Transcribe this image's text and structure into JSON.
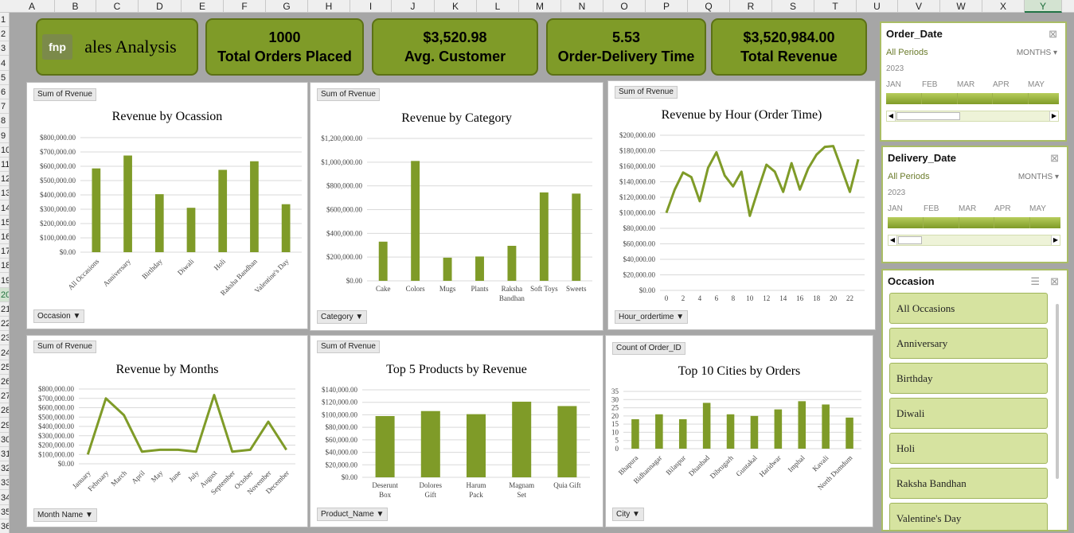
{
  "columns": [
    "A",
    "B",
    "C",
    "D",
    "E",
    "F",
    "G",
    "H",
    "I",
    "J",
    "K",
    "L",
    "M",
    "N",
    "O",
    "P",
    "Q",
    "R",
    "S",
    "T",
    "U",
    "V",
    "W",
    "X",
    "Y"
  ],
  "rows": [
    "1",
    "2",
    "3",
    "4",
    "5",
    "6",
    "7",
    "8",
    "9",
    "10",
    "11",
    "12",
    "13",
    "14",
    "15",
    "16",
    "17",
    "18",
    "19",
    "20",
    "21",
    "22",
    "23",
    "24",
    "25",
    "26",
    "27",
    "28",
    "29",
    "30",
    "31",
    "32",
    "33",
    "34",
    "35",
    "36"
  ],
  "selected_column": "Y",
  "selected_row": "20",
  "kpis": {
    "title_logo": "fnp",
    "title_text": "ales Analysis",
    "orders_value": "1000",
    "orders_label": "Total Orders Placed",
    "avg_value": "$3,520.98",
    "avg_label": "Avg. Customer",
    "delivery_value": "5.53",
    "delivery_label": "Order-Delivery Time",
    "revenue_value": "$3,520,984.00",
    "revenue_label": "Total Revenue"
  },
  "charts": {
    "occasion": {
      "tag": "Sum of Rvenue",
      "title": "Revenue by Ocassion",
      "filter": "Occasion"
    },
    "category": {
      "tag": "Sum of Rvenue",
      "title": "Revenue by Category",
      "filter": "Category"
    },
    "hour": {
      "tag": "Sum of Rvenue",
      "title": "Revenue by Hour (Order Time)",
      "filter": "Hour_ordertime"
    },
    "months": {
      "tag": "Sum of Rvenue",
      "title": "Revenue by Months",
      "filter": "Month Name"
    },
    "products": {
      "tag": "Sum of Rvenue",
      "title": "Top 5 Products by Revenue",
      "filter": "Product_Name"
    },
    "cities": {
      "tag": "Count of Order_ID",
      "title": "Top 10 Cities by Orders",
      "filter": "City"
    }
  },
  "chart_data": [
    {
      "id": "occasion",
      "type": "bar",
      "title": "Revenue by Ocassion",
      "categories": [
        "All Occasions",
        "Anniversary",
        "Birthday",
        "Diwali",
        "Holi",
        "Raksha Bandhan",
        "Valentine's Day"
      ],
      "values": [
        585000,
        675000,
        405000,
        310000,
        575000,
        635000,
        335000
      ],
      "ylim": [
        0,
        800000
      ],
      "yticks": [
        "$0.00",
        "$100,000.00",
        "$200,000.00",
        "$300,000.00",
        "$400,000.00",
        "$500,000.00",
        "$600,000.00",
        "$700,000.00",
        "$800,000.00"
      ],
      "color": "#7f9b28"
    },
    {
      "id": "category",
      "type": "bar",
      "title": "Revenue by Category",
      "categories": [
        "Cake",
        "Colors",
        "Mugs",
        "Plants",
        "Raksha Bandhan",
        "Soft Toys",
        "Sweets"
      ],
      "values": [
        330000,
        1010000,
        195000,
        205000,
        295000,
        745000,
        735000
      ],
      "ylim": [
        0,
        1200000
      ],
      "yticks": [
        "$0.00",
        "$200,000.00",
        "$400,000.00",
        "$600,000.00",
        "$800,000.00",
        "$1,000,000.00",
        "$1,200,000.00"
      ],
      "color": "#7f9b28"
    },
    {
      "id": "hour",
      "type": "line",
      "title": "Revenue by Hour (Order Time)",
      "x": [
        0,
        1,
        2,
        3,
        4,
        5,
        6,
        7,
        8,
        9,
        10,
        11,
        12,
        13,
        14,
        15,
        16,
        17,
        18,
        19,
        20,
        21,
        22,
        23
      ],
      "values": [
        100000,
        130000,
        152000,
        146000,
        115000,
        158000,
        178000,
        148000,
        134000,
        153000,
        96000,
        130000,
        162000,
        153000,
        127000,
        164000,
        130000,
        157000,
        175000,
        185000,
        186000,
        157000,
        127000,
        169000
      ],
      "xticks": [
        "0",
        "2",
        "4",
        "6",
        "8",
        "10",
        "12",
        "14",
        "16",
        "18",
        "20",
        "22"
      ],
      "ylim": [
        0,
        200000
      ],
      "yticks": [
        "$0.00",
        "$20,000.00",
        "$40,000.00",
        "$60,000.00",
        "$80,000.00",
        "$100,000.00",
        "$120,000.00",
        "$140,000.00",
        "$160,000.00",
        "$180,000.00",
        "$200,000.00"
      ],
      "color": "#7f9b28"
    },
    {
      "id": "months",
      "type": "line",
      "title": "Revenue by Months",
      "categories": [
        "January",
        "February",
        "March",
        "April",
        "May",
        "June",
        "July",
        "August",
        "September",
        "October",
        "November",
        "December"
      ],
      "values": [
        100000,
        700000,
        520000,
        130000,
        150000,
        150000,
        130000,
        735000,
        130000,
        150000,
        450000,
        150000
      ],
      "ylim": [
        0,
        800000
      ],
      "yticks": [
        "$0.00",
        "$100,000.00",
        "$200,000.00",
        "$300,000.00",
        "$400,000.00",
        "$500,000.00",
        "$600,000.00",
        "$700,000.00",
        "$800,000.00"
      ],
      "color": "#7f9b28"
    },
    {
      "id": "products",
      "type": "bar",
      "title": "Top 5 Products by Revenue",
      "categories": [
        "Deserunt Box",
        "Dolores Gift",
        "Harum Pack",
        "Magnam Set",
        "Quia Gift"
      ],
      "values": [
        98000,
        106000,
        101000,
        121000,
        114000
      ],
      "ylim": [
        0,
        140000
      ],
      "yticks": [
        "$0.00",
        "$20,000.00",
        "$40,000.00",
        "$60,000.00",
        "$80,000.00",
        "$100,000.00",
        "$120,000.00",
        "$140,000.00"
      ],
      "color": "#7f9b28"
    },
    {
      "id": "cities",
      "type": "bar",
      "title": "Top 10 Cities by Orders",
      "categories": [
        "Bhapura",
        "Bidhannagar",
        "Bilaspur",
        "Dhanbad",
        "Dibrugarh",
        "Guntakal",
        "Haridwar",
        "Imphal",
        "Kavali",
        "North Dumdum"
      ],
      "values": [
        18,
        21,
        18,
        28,
        21,
        20,
        24,
        29,
        27,
        19
      ],
      "ylim": [
        0,
        35
      ],
      "yticks": [
        "0",
        "5",
        "10",
        "15",
        "20",
        "25",
        "30",
        "35"
      ],
      "color": "#7f9b28"
    }
  ],
  "slicers": {
    "order_date": {
      "title": "Order_Date",
      "period": "All Periods",
      "unit": "MONTHS",
      "year": "2023",
      "months": [
        "JAN",
        "FEB",
        "MAR",
        "APR",
        "MAY"
      ]
    },
    "delivery_date": {
      "title": "Delivery_Date",
      "period": "All Periods",
      "unit": "MONTHS",
      "year": "2023",
      "months": [
        "JAN",
        "FEB",
        "MAR",
        "APR",
        "MAY"
      ]
    },
    "occasion": {
      "title": "Occasion",
      "items": [
        "All Occasions",
        "Anniversary",
        "Birthday",
        "Diwali",
        "Holi",
        "Raksha Bandhan",
        "Valentine's Day"
      ]
    }
  }
}
